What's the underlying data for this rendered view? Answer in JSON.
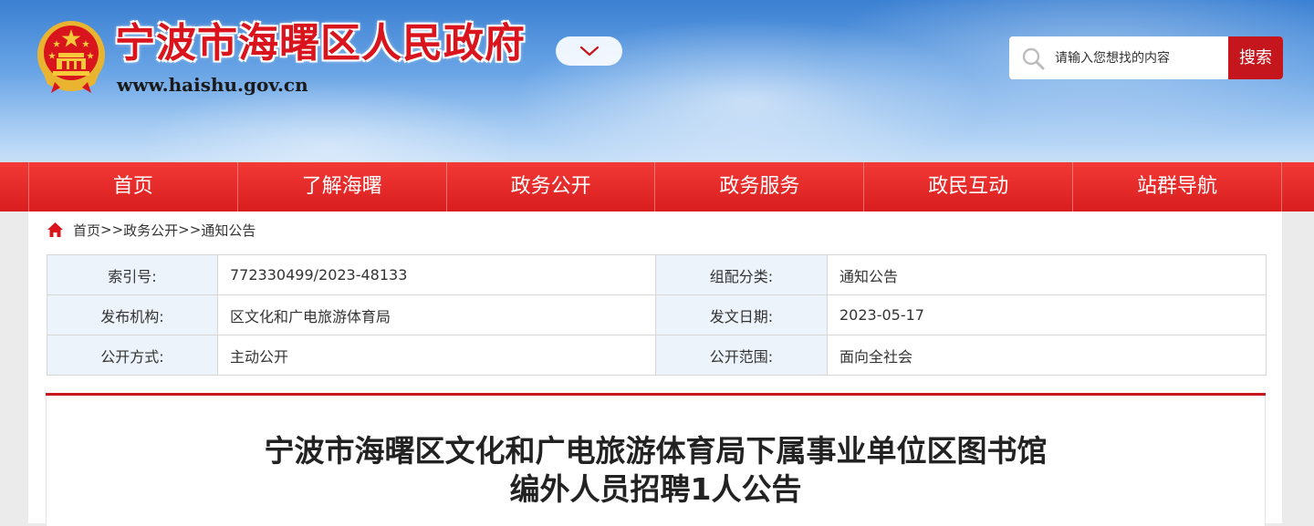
{
  "header": {
    "site_title": "宁波市海曙区人民政府",
    "site_url": "www.haishu.gov.cn",
    "search": {
      "placeholder": "请输入您想找的内容",
      "button_label": "搜索"
    }
  },
  "nav": {
    "items": [
      {
        "label": "首页"
      },
      {
        "label": "了解海曙"
      },
      {
        "label": "政务公开"
      },
      {
        "label": "政务服务"
      },
      {
        "label": "政民互动"
      },
      {
        "label": "站群导航"
      }
    ]
  },
  "breadcrumb": {
    "home": "首页",
    "sep1": ">>",
    "item1": "政务公开",
    "sep2": ">>",
    "item2": "通知公告"
  },
  "meta": {
    "rows": [
      {
        "label1": "索引号:",
        "value1": "772330499/2023-48133",
        "label2": "组配分类:",
        "value2": "通知公告"
      },
      {
        "label1": "发布机构:",
        "value1": "区文化和广电旅游体育局",
        "label2": "发文日期:",
        "value2": "2023-05-17"
      },
      {
        "label1": "公开方式:",
        "value1": "主动公开",
        "label2": "公开范围:",
        "value2": "面向全社会"
      }
    ]
  },
  "article": {
    "title_line1": "宁波市海曙区文化和广电旅游体育局下属事业单位区图书馆",
    "title_line2": "编外人员招聘1人公告"
  },
  "colors": {
    "brand_red": "#d9141c",
    "nav_red": "#e02a29",
    "table_label_bg": "#edf3fb",
    "header_blue": "#4a8ad8"
  },
  "icons": [
    "national-emblem-icon",
    "chevron-down-icon",
    "search-icon",
    "home-icon"
  ]
}
